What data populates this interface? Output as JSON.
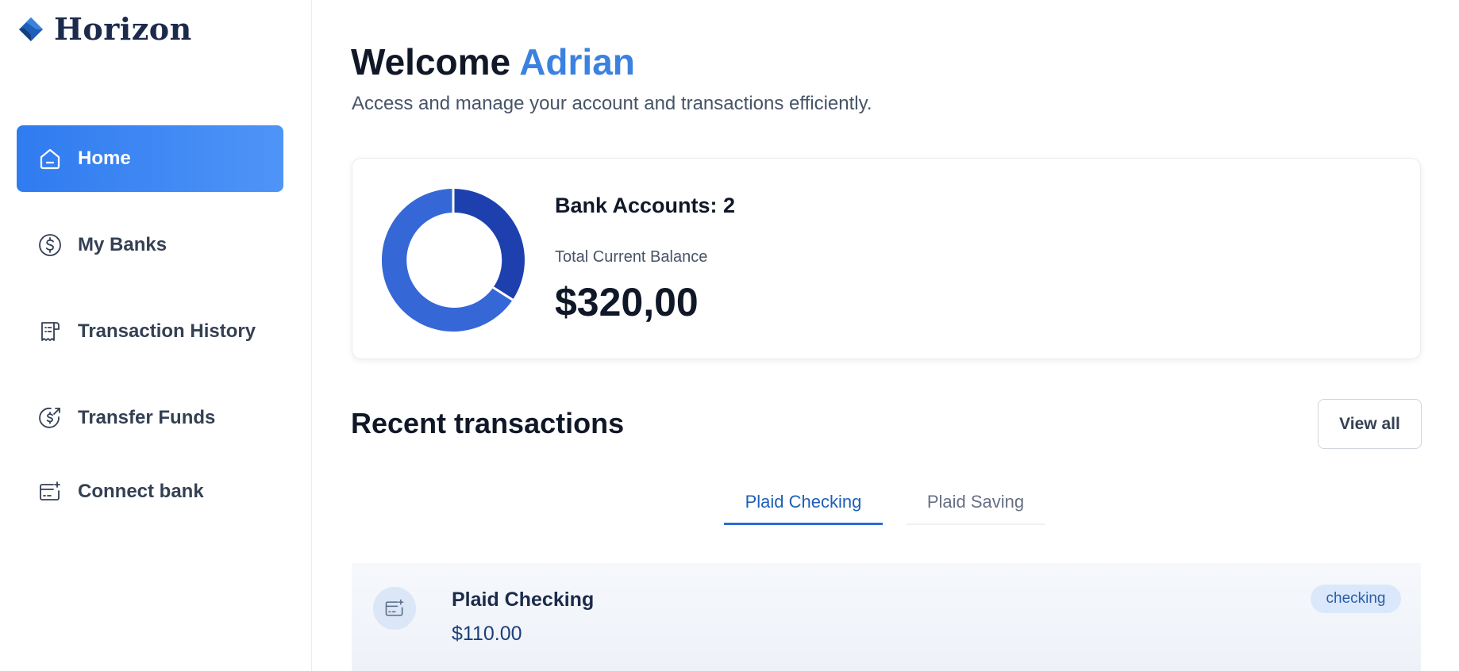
{
  "app": {
    "logo_text": "Horizon",
    "accent_color": "#3b82e0",
    "brand_color": "#1c2b4b"
  },
  "sidebar": {
    "items": [
      {
        "label": "Home",
        "icon": "home-icon",
        "active": true
      },
      {
        "label": "My Banks",
        "icon": "dollar-circle-icon",
        "active": false
      },
      {
        "label": "Transaction History",
        "icon": "receipt-icon",
        "active": false
      },
      {
        "label": "Transfer Funds",
        "icon": "money-send-icon",
        "active": false
      },
      {
        "label": "Connect bank",
        "icon": "card-add-icon",
        "active": false
      }
    ]
  },
  "header": {
    "welcome_prefix": "Welcome",
    "user_name": "Adrian",
    "subtitle": "Access and manage your account and transactions efficiently."
  },
  "balance": {
    "bank_accounts_label": "Bank Accounts: 2",
    "total_label": "Total Current Balance",
    "total_value": "$320,00",
    "chart_colors": [
      "#1e40af",
      "#3567d6"
    ]
  },
  "recent": {
    "title": "Recent transactions",
    "view_all_label": "View all",
    "tabs": [
      {
        "label": "Plaid Checking",
        "active": true
      },
      {
        "label": "Plaid Saving",
        "active": false
      }
    ],
    "account": {
      "name": "Plaid Checking",
      "balance": "$110.00",
      "badge": "checking",
      "icon": "card-add-icon"
    }
  }
}
